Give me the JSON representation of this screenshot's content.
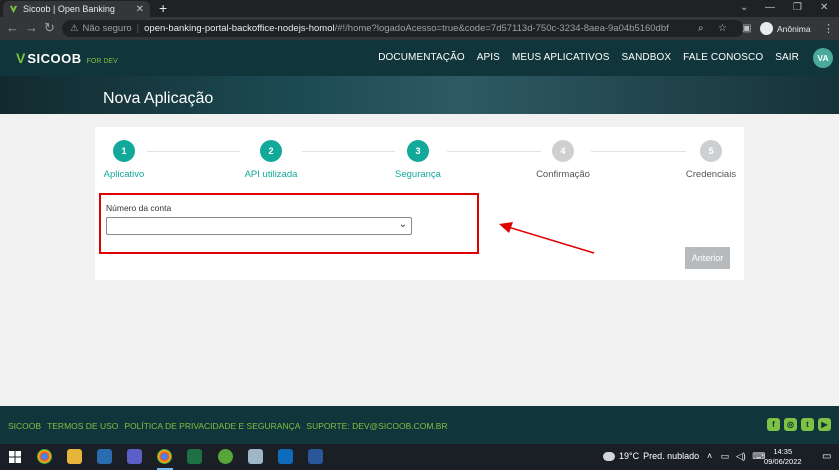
{
  "browser": {
    "tab_title": "Sicoob | Open Banking",
    "tab_close": "✕",
    "new_tab": "+",
    "window_controls": [
      "⌄",
      "—",
      "❐",
      "✕"
    ],
    "address": {
      "security_label": "Não seguro",
      "host": "open-banking-portal-backoffice-nodejs-homol",
      "path": "/#!/home?logadoAcesso=true&code=7d57113d-750c-3234-8aea-9a04b5160dbf"
    },
    "profile_label": "Anônima"
  },
  "header": {
    "brand": "SICOOB",
    "brand_sub": "FOR DEV",
    "nav": [
      "DOCUMENTAÇÃO",
      "APIS",
      "MEUS APLICATIVOS",
      "SANDBOX",
      "FALE CONOSCO",
      "SAIR"
    ],
    "avatar_initials": "VA"
  },
  "banner": {
    "title": "Nova Aplicação"
  },
  "wizard": {
    "steps": [
      {
        "number": "1",
        "label": "Aplicativo",
        "state": "active"
      },
      {
        "number": "2",
        "label": "API utilizada",
        "state": "active"
      },
      {
        "number": "3",
        "label": "Segurança",
        "state": "active"
      },
      {
        "number": "4",
        "label": "Confirmação",
        "state": "inactive"
      },
      {
        "number": "5",
        "label": "Credenciais",
        "state": "inactive"
      }
    ],
    "field_label": "Número da conta",
    "select_value": "",
    "back_button": "Anterior"
  },
  "footer": {
    "links": [
      "SICOOB",
      "TERMOS DE USO",
      "POLÍTICA DE PRIVACIDADE E SEGURANÇA",
      "SUPORTE: DEV@SICOOB.COM.BR"
    ],
    "social_icons": [
      "facebook-icon",
      "instagram-icon",
      "twitter-icon",
      "youtube-icon"
    ]
  },
  "taskbar": {
    "weather_temp": "19°C",
    "weather_text": "Pred. nublado",
    "time": "14:35",
    "date": "09/06/2022"
  },
  "colors": {
    "brand_dark": "#10353b",
    "brand_green": "#7dc242",
    "step_active": "#12a99b",
    "step_inactive": "#cdcfd1",
    "annotation_red": "#e00000"
  }
}
